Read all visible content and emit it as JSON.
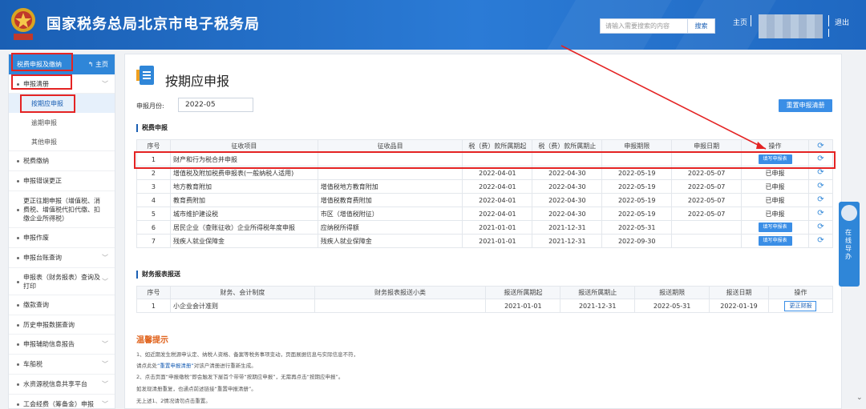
{
  "header": {
    "title": "国家税务总局北京市电子税务局",
    "search_placeholder": "请输入需要搜索的内容",
    "search_button": "搜索",
    "home": "主页",
    "sep1": "|",
    "sep2": "|",
    "logout": "退出"
  },
  "sidebar": {
    "title": "税费申报及缴纳",
    "home": "主页",
    "items": [
      {
        "label": "申报清册",
        "chev": "﹀"
      },
      {
        "label": "税费缴纳"
      },
      {
        "label": "申报错误更正"
      },
      {
        "label": "更正往期申报（增值税、消费税、增值税代扣代缴、扣缴企业所得税）"
      },
      {
        "label": "申报作废"
      },
      {
        "label": "申报台账查询",
        "chev": "﹀"
      },
      {
        "label": "申报表（财务报表）查询及打印",
        "chev": "﹀"
      },
      {
        "label": "缴款查询"
      },
      {
        "label": "历史申报数据查询"
      },
      {
        "label": "申报辅助信息报告",
        "chev": "﹀"
      },
      {
        "label": "车船税",
        "chev": "﹀"
      },
      {
        "label": "水资源税信息共享平台",
        "chev": "﹀"
      },
      {
        "label": "工会经费（筹备金）申报",
        "chev": "﹀"
      }
    ],
    "sub_items": [
      "按期应申报",
      "逾期申报",
      "其他申报"
    ]
  },
  "main": {
    "page_title": "按期应申报",
    "period_label": "申报月份:",
    "period_value": "2022-05",
    "reset_button": "重置申报清册",
    "tax_section": "税费申报",
    "tax_headers": [
      "序号",
      "征收项目",
      "征收品目",
      "税（费）款所属期起",
      "税（费）款所属期止",
      "申报期限",
      "申报日期",
      "操作"
    ],
    "tax_rows": [
      {
        "no": "1",
        "item": "财产和行为税合并申报",
        "sub": "",
        "from": "",
        "to": "",
        "deadline": "",
        "date": "",
        "op": "填写申报表"
      },
      {
        "no": "2",
        "item": "增值税及附加税费申报表(一般纳税人适用)",
        "sub": "",
        "from": "2022-04-01",
        "to": "2022-04-30",
        "deadline": "2022-05-19",
        "date": "2022-05-07",
        "op": "已申报"
      },
      {
        "no": "3",
        "item": "地方教育附加",
        "sub": "增值税地方教育附加",
        "from": "2022-04-01",
        "to": "2022-04-30",
        "deadline": "2022-05-19",
        "date": "2022-05-07",
        "op": "已申报"
      },
      {
        "no": "4",
        "item": "教育费附加",
        "sub": "增值税教育费附加",
        "from": "2022-04-01",
        "to": "2022-04-30",
        "deadline": "2022-05-19",
        "date": "2022-05-07",
        "op": "已申报"
      },
      {
        "no": "5",
        "item": "城市维护建设税",
        "sub": "市区（增值税附征）",
        "from": "2022-04-01",
        "to": "2022-04-30",
        "deadline": "2022-05-19",
        "date": "2022-05-07",
        "op": "已申报"
      },
      {
        "no": "6",
        "item": "居民企业（查账征收）企业所得税年度申报",
        "sub": "应纳税所得额",
        "from": "2021-01-01",
        "to": "2021-12-31",
        "deadline": "2022-05-31",
        "date": "",
        "op": "填写申报表"
      },
      {
        "no": "7",
        "item": "残疾人就业保障金",
        "sub": "残疾人就业保障金",
        "from": "2021-01-01",
        "to": "2021-12-31",
        "deadline": "2022-09-30",
        "date": "",
        "op": "填写申报表"
      }
    ],
    "fin_section": "财务报表报送",
    "fin_headers": [
      "序号",
      "财务、会计制度",
      "财务报表报送小类",
      "报送所属期起",
      "报送所属期止",
      "报送期限",
      "报送日期",
      "操作"
    ],
    "fin_rows": [
      {
        "no": "1",
        "system": "小企业会计准则",
        "sub": "",
        "from": "2021-01-01",
        "to": "2021-12-31",
        "deadline": "2022-05-31",
        "date": "2022-01-19",
        "op": "更正财报"
      }
    ],
    "tips_title": "温馨提示",
    "tips": [
      "1、如近期发生税源申认定、纳税人资格、备案等税务事项变动，页面展据信息与实际信息不符，",
      "请点此处",
      "“重置申报清册”",
      "对该户清册进行重新生成。",
      "2、点击页面“申报缴税”即会触发下屋首个带带“按期应申报”，无需再点击“按期应申报”。",
      "如发现清册重复，也通点前述链接“重置申报清册”。",
      "无上述1、2情况请勿点击重置。"
    ]
  },
  "online_service": {
    "label": "在线导办"
  },
  "colors": {
    "header_blue": "#1a5fb4",
    "accent": "#2f86d8",
    "highlight_red": "#e42323",
    "tip_orange": "#e0621b"
  }
}
